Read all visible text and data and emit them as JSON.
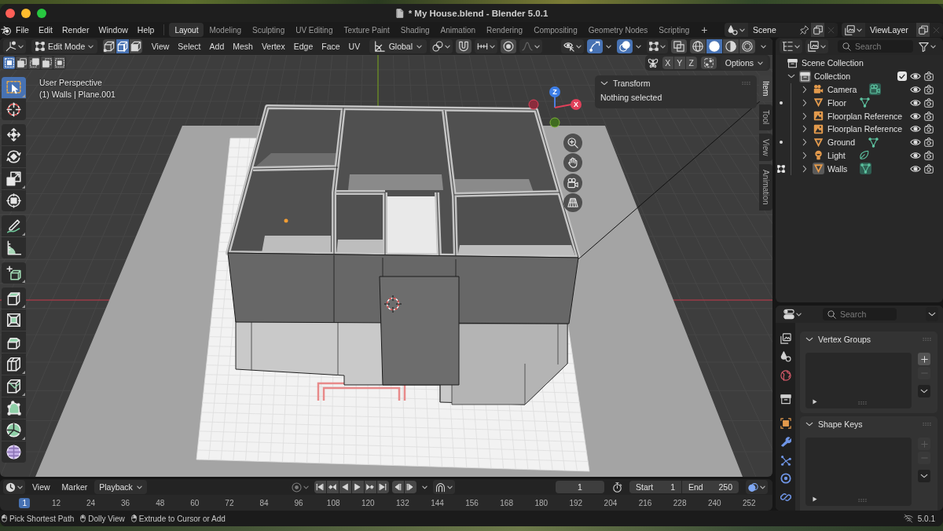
{
  "window": {
    "title": "* My House.blend - Blender 5.0.1"
  },
  "menu_bar": {
    "menus": [
      "File",
      "Edit",
      "Render",
      "Window",
      "Help"
    ],
    "workspaces": [
      {
        "label": "Layout",
        "selected": true
      },
      {
        "label": "Modeling",
        "selected": false
      },
      {
        "label": "Sculpting",
        "selected": false
      },
      {
        "label": "UV Editing",
        "selected": false
      },
      {
        "label": "Texture Paint",
        "selected": false
      },
      {
        "label": "Shading",
        "selected": false
      },
      {
        "label": "Animation",
        "selected": false
      },
      {
        "label": "Rendering",
        "selected": false
      },
      {
        "label": "Compositing",
        "selected": false
      },
      {
        "label": "Geometry Nodes",
        "selected": false
      },
      {
        "label": "Scripting",
        "selected": false
      }
    ],
    "add_workspace": "+",
    "scene": "Scene",
    "view_layer": "ViewLayer"
  },
  "viewport": {
    "header": {
      "mode": "Edit Mode",
      "select_modes": [
        {
          "kind": "vertex",
          "selected": false
        },
        {
          "kind": "edge",
          "selected": true
        },
        {
          "kind": "face",
          "selected": false
        }
      ],
      "menus": [
        "View",
        "Select",
        "Add",
        "Mesh",
        "Vertex",
        "Edge",
        "Face",
        "UV"
      ],
      "orientation": "Global",
      "gizmos": true,
      "overlays": true,
      "xray": false,
      "shading": [
        {
          "kind": "wireframe",
          "selected": false
        },
        {
          "kind": "solid",
          "selected": true
        },
        {
          "kind": "material",
          "selected": false
        },
        {
          "kind": "rendered",
          "selected": false
        }
      ]
    },
    "select_box_modes": [
      {
        "kind": "new",
        "selected": true
      },
      {
        "kind": "extend",
        "selected": false
      },
      {
        "kind": "subtract",
        "selected": false
      },
      {
        "kind": "invert",
        "selected": false
      },
      {
        "kind": "intersect",
        "selected": false
      }
    ],
    "mirror_axes": [
      {
        "label": "X",
        "on": false
      },
      {
        "label": "Y",
        "on": false
      },
      {
        "label": "Z",
        "on": false
      }
    ],
    "options": "Options",
    "view_name": "User Perspective",
    "object_info": "(1) Walls | Plane.001",
    "gizmo_axes": [
      "Z",
      "X"
    ],
    "tool_groups": [
      {
        "tools": [
          {
            "kind": "select-box",
            "selected": true,
            "has_variants": true
          },
          {
            "kind": "cursor",
            "selected": false,
            "has_variants": false
          }
        ]
      },
      {
        "tools": [
          {
            "kind": "move",
            "selected": false,
            "has_variants": false
          },
          {
            "kind": "rotate",
            "selected": false,
            "has_variants": false
          },
          {
            "kind": "scale",
            "selected": false,
            "has_variants": true
          },
          {
            "kind": "transform",
            "selected": false,
            "has_variants": false
          }
        ]
      },
      {
        "tools": [
          {
            "kind": "annotate",
            "selected": false,
            "has_variants": true
          },
          {
            "kind": "measure",
            "selected": false,
            "has_variants": false
          }
        ]
      },
      {
        "tools": [
          {
            "kind": "add-cube",
            "selected": false,
            "has_variants": true
          }
        ]
      },
      {
        "tools": [
          {
            "kind": "extrude",
            "selected": false,
            "has_variants": true
          },
          {
            "kind": "inset",
            "selected": false,
            "has_variants": false
          },
          {
            "kind": "bevel",
            "selected": false,
            "has_variants": false
          },
          {
            "kind": "loop-cut",
            "selected": false,
            "has_variants": true
          },
          {
            "kind": "knife",
            "selected": false,
            "has_variants": true
          },
          {
            "kind": "poly-build",
            "selected": false,
            "has_variants": false
          },
          {
            "kind": "spin",
            "selected": false,
            "has_variants": true
          },
          {
            "kind": "smooth",
            "selected": false,
            "has_variants": false
          }
        ]
      }
    ],
    "sidebar": {
      "tabs": [
        {
          "label": "Item",
          "selected": true
        },
        {
          "label": "Tool",
          "selected": false
        },
        {
          "label": "View",
          "selected": false
        },
        {
          "label": "Animation",
          "selected": false
        }
      ],
      "panel": {
        "title": "Transform",
        "expanded": true,
        "message": "Nothing selected"
      }
    }
  },
  "outliner": {
    "search": {
      "placeholder": "Search"
    },
    "scene_collection": "Scene Collection",
    "collection": {
      "name": "Collection",
      "expanded": true,
      "active": true,
      "checked": true,
      "children": [
        {
          "name": "Camera",
          "kind": "camera",
          "editing": false,
          "edit_available": false,
          "expanded": false,
          "active": false,
          "data_highlighted": true
        },
        {
          "name": "Floor",
          "kind": "mesh",
          "editing": false,
          "edit_available": true,
          "expanded": false,
          "active": false,
          "data_highlighted": false
        },
        {
          "name": "Floorplan Reference",
          "kind": "image",
          "editing": false,
          "edit_available": false,
          "expanded": false,
          "active": false
        },
        {
          "name": "Floorplan Reference",
          "kind": "image",
          "editing": false,
          "edit_available": false,
          "expanded": false,
          "active": false
        },
        {
          "name": "Ground",
          "kind": "mesh",
          "editing": false,
          "edit_available": true,
          "expanded": false,
          "active": false,
          "data_highlighted": false
        },
        {
          "name": "Light",
          "kind": "light",
          "editing": false,
          "edit_available": false,
          "expanded": false,
          "active": false,
          "data_highlighted": false
        },
        {
          "name": "Walls",
          "kind": "mesh",
          "editing": true,
          "edit_available": false,
          "expanded": false,
          "active": true,
          "data_highlighted": true
        }
      ]
    }
  },
  "properties": {
    "search": {
      "placeholder": "Search"
    },
    "panels": [
      {
        "title": "Vertex Groups",
        "expanded": true,
        "add_disabled": false,
        "remove_disabled": true
      },
      {
        "title": "Shape Keys",
        "expanded": true,
        "add_disabled": true,
        "remove_disabled": true
      }
    ]
  },
  "timeline": {
    "menus": [
      "View",
      "Marker"
    ],
    "playback": "Playback",
    "current_frame": "1",
    "start": {
      "label": "Start",
      "value": "1"
    },
    "end": {
      "label": "End",
      "value": "250"
    },
    "ruler": [
      {
        "label": "1",
        "selected": true
      },
      {
        "label": "12",
        "selected": false
      },
      {
        "label": "24",
        "selected": false
      },
      {
        "label": "36",
        "selected": false
      },
      {
        "label": "48",
        "selected": false
      },
      {
        "label": "60",
        "selected": false
      },
      {
        "label": "72",
        "selected": false
      },
      {
        "label": "84",
        "selected": false
      },
      {
        "label": "96",
        "selected": false
      },
      {
        "label": "108",
        "selected": false
      },
      {
        "label": "120",
        "selected": false
      },
      {
        "label": "132",
        "selected": false
      },
      {
        "label": "144",
        "selected": false
      },
      {
        "label": "156",
        "selected": false
      },
      {
        "label": "168",
        "selected": false
      },
      {
        "label": "180",
        "selected": false
      },
      {
        "label": "192",
        "selected": false
      },
      {
        "label": "204",
        "selected": false
      },
      {
        "label": "216",
        "selected": false
      },
      {
        "label": "228",
        "selected": false
      },
      {
        "label": "240",
        "selected": false
      },
      {
        "label": "252",
        "selected": false
      }
    ]
  },
  "status_bar": {
    "hints": [
      {
        "kind": "left",
        "text": "Pick Shortest Path"
      },
      {
        "kind": "middle",
        "text": "Dolly View"
      },
      {
        "kind": "right",
        "text": "Extrude to Cursor or Add"
      }
    ],
    "version": "5.0.1"
  }
}
